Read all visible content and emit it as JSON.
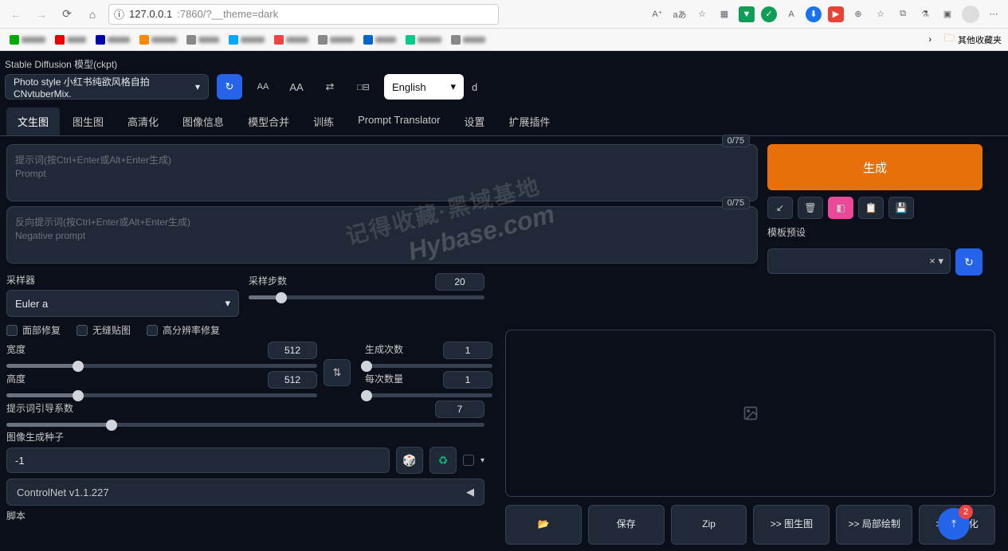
{
  "browser": {
    "url_host": "127.0.0.1",
    "url_port_path": ":7860/?__theme=dark",
    "bookmarks_folder": "其他收藏夹"
  },
  "header": {
    "model_label": "Stable Diffusion 模型(ckpt)",
    "model_value": "Photo style 小红书纯欲风格自拍 CNvtuberMix.",
    "language": "English",
    "d_label": "d"
  },
  "tabs": [
    {
      "label": "文生图",
      "active": true
    },
    {
      "label": "图生图",
      "active": false
    },
    {
      "label": "高清化",
      "active": false
    },
    {
      "label": "图像信息",
      "active": false
    },
    {
      "label": "模型合并",
      "active": false
    },
    {
      "label": "训练",
      "active": false
    },
    {
      "label": "Prompt Translator",
      "active": false
    },
    {
      "label": "设置",
      "active": false
    },
    {
      "label": "扩展插件",
      "active": false
    }
  ],
  "prompt": {
    "positive_placeholder_line1": "提示词(按Ctrl+Enter或Alt+Enter生成)",
    "positive_placeholder_line2": "Prompt",
    "positive_counter": "0/75",
    "negative_placeholder_line1": "反向提示词(按Ctrl+Enter或Alt+Enter生成)",
    "negative_placeholder_line2": "Negative prompt",
    "negative_counter": "0/75"
  },
  "sampler": {
    "label": "采样器",
    "value": "Euler a",
    "steps_label": "采样步数",
    "steps_value": "20"
  },
  "checks": {
    "face_restore": "面部修复",
    "tiling": "无缝贴图",
    "hires": "高分辨率修复"
  },
  "dims": {
    "width_label": "宽度",
    "width_value": "512",
    "height_label": "高度",
    "height_value": "512",
    "batch_count_label": "生成次数",
    "batch_count_value": "1",
    "batch_size_label": "每次数量",
    "batch_size_value": "1"
  },
  "cfg": {
    "label": "提示词引导系数",
    "value": "7"
  },
  "seed": {
    "label": "图像生成种子",
    "value": "-1"
  },
  "accordion": {
    "controlnet": "ControlNet v1.1.227"
  },
  "script_label": "脚本",
  "right": {
    "generate": "生成",
    "preset_label": "模板预设"
  },
  "actions": {
    "folder": "📂",
    "save": "保存",
    "zip": "Zip",
    "img2img": ">> 图生图",
    "inpaint": ">> 局部绘制",
    "hires": ">> 高清化"
  },
  "float_badge": "2",
  "watermark1": "记得收藏·黑域基地",
  "watermark2": "Hybase.com"
}
